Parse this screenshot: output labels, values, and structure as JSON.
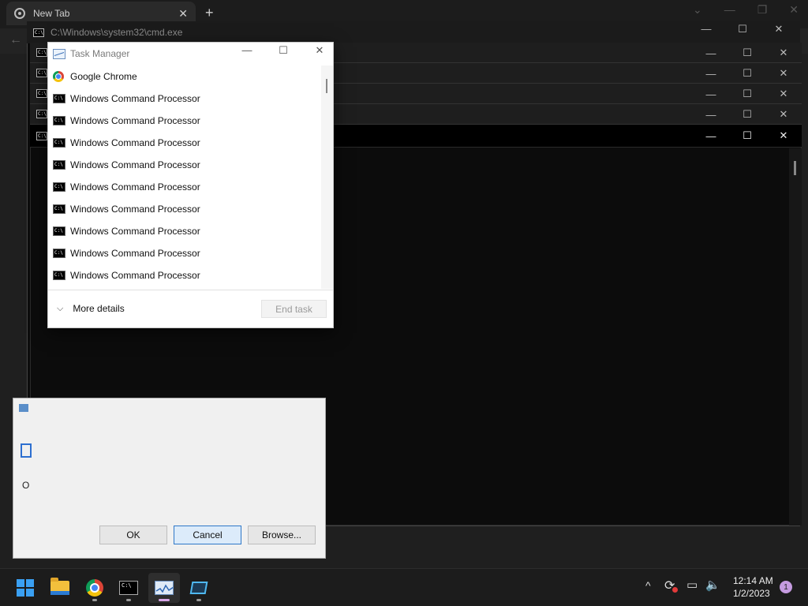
{
  "chrome": {
    "tab_title": "New Tab",
    "tab_close": "✕",
    "new_tab": "+",
    "window_controls": [
      "⌄",
      "—",
      "❐",
      "✕"
    ],
    "back": "←"
  },
  "cmd": {
    "main_title": "C:\\Windows\\system32\\cmd.exe",
    "icon_text": "C:\\",
    "controls": [
      "—",
      "☐",
      "✕"
    ]
  },
  "run_dialog": {
    "partial_label": "O",
    "buttons": {
      "ok": "OK",
      "cancel": "Cancel",
      "browse": "Browse..."
    }
  },
  "task_manager": {
    "title": "Task Manager",
    "controls": [
      "—",
      "☐",
      "✕"
    ],
    "processes": [
      {
        "name": "Google Chrome",
        "icon": "chrome-icon"
      },
      {
        "name": "Windows Command Processor",
        "icon": "cmd-icon"
      },
      {
        "name": "Windows Command Processor",
        "icon": "cmd-icon"
      },
      {
        "name": "Windows Command Processor",
        "icon": "cmd-icon"
      },
      {
        "name": "Windows Command Processor",
        "icon": "cmd-icon"
      },
      {
        "name": "Windows Command Processor",
        "icon": "cmd-icon"
      },
      {
        "name": "Windows Command Processor",
        "icon": "cmd-icon"
      },
      {
        "name": "Windows Command Processor",
        "icon": "cmd-icon"
      },
      {
        "name": "Windows Command Processor",
        "icon": "cmd-icon"
      },
      {
        "name": "Windows Command Processor",
        "icon": "cmd-icon"
      }
    ],
    "more_details": "More details",
    "more_details_chevron": "⌵",
    "end_task": "End task"
  },
  "taskbar": {
    "apps": [
      "start-icon",
      "file-explorer-icon",
      "chrome-icon",
      "cmd-icon",
      "task-manager-icon",
      "app-icon"
    ],
    "tray": {
      "chevron": "^",
      "sync": "⟳",
      "network": "▭",
      "volume": "🔈",
      "time": "12:14 AM",
      "date": "1/2/2023",
      "notification_count": "1"
    }
  }
}
